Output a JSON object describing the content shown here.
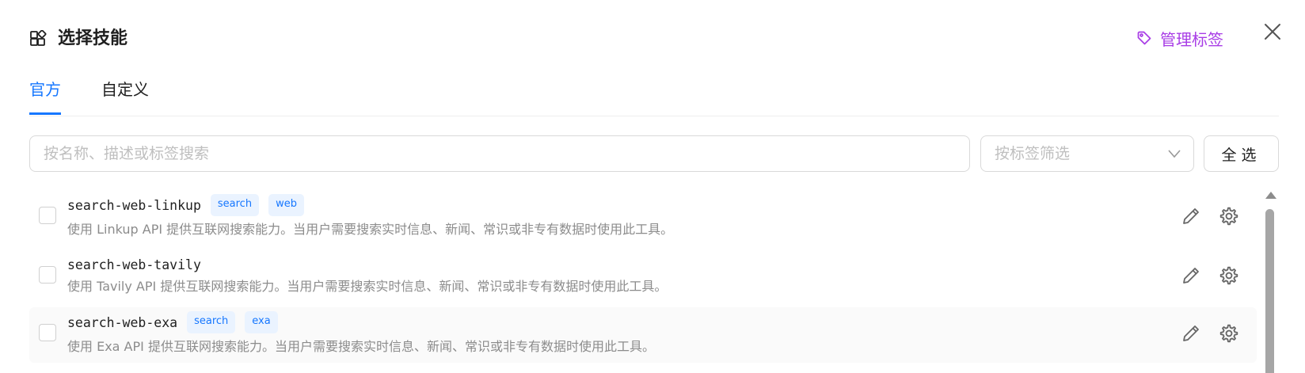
{
  "dialog": {
    "title": "选择技能",
    "manage_tags_label": "管理标签"
  },
  "tabs": [
    {
      "label": "官方",
      "active": true
    },
    {
      "label": "自定义",
      "active": false
    }
  ],
  "toolbar": {
    "search_placeholder": "按名称、描述或标签搜索",
    "tag_filter_placeholder": "按标签筛选",
    "select_all_label": "全选"
  },
  "skills": [
    {
      "name": "search-web-linkup",
      "tags": [
        "search",
        "web"
      ],
      "description": "使用 Linkup API 提供互联网搜索能力。当用户需要搜索实时信息、新闻、常识或非专有数据时使用此工具。",
      "checked": false
    },
    {
      "name": "search-web-tavily",
      "tags": [],
      "description": "使用 Tavily API 提供互联网搜索能力。当用户需要搜索实时信息、新闻、常识或非专有数据时使用此工具。",
      "checked": false
    },
    {
      "name": "search-web-exa",
      "tags": [
        "search",
        "exa"
      ],
      "description": "使用 Exa API 提供互联网搜索能力。当用户需要搜索实时信息、新闻、常识或非专有数据时使用此工具。",
      "checked": false
    }
  ],
  "icons": {
    "title": "apps-icon",
    "manage_tags": "tag-icon",
    "close": "close-icon",
    "dropdown": "chevron-down-icon",
    "edit": "pencil-icon",
    "settings": "gear-icon"
  },
  "colors": {
    "accent": "#1677ff",
    "manage_tags": "#a83ce6",
    "tag_bg": "#eaf3ff",
    "muted_text": "#8c8c8c"
  }
}
